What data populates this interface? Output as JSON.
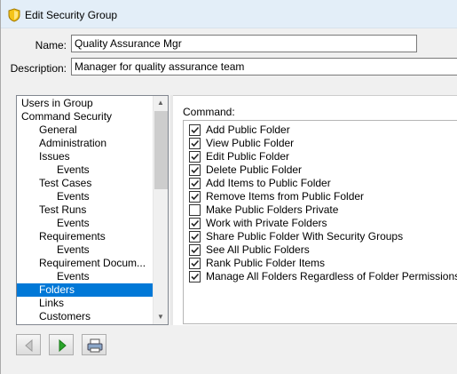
{
  "window": {
    "title": "Edit Security Group"
  },
  "form": {
    "name_label": "Name:",
    "name_value": "Quality Assurance Mgr",
    "description_label": "Description:",
    "description_value": "Manager for quality assurance team"
  },
  "tree": {
    "items": [
      {
        "label": "Users in Group",
        "level": 0,
        "selected": false
      },
      {
        "label": "Command Security",
        "level": 0,
        "selected": false
      },
      {
        "label": "General",
        "level": 1,
        "selected": false
      },
      {
        "label": "Administration",
        "level": 1,
        "selected": false
      },
      {
        "label": "Issues",
        "level": 1,
        "selected": false
      },
      {
        "label": "Events",
        "level": 2,
        "selected": false
      },
      {
        "label": "Test Cases",
        "level": 1,
        "selected": false
      },
      {
        "label": "Events",
        "level": 2,
        "selected": false
      },
      {
        "label": "Test Runs",
        "level": 1,
        "selected": false
      },
      {
        "label": "Events",
        "level": 2,
        "selected": false
      },
      {
        "label": "Requirements",
        "level": 1,
        "selected": false
      },
      {
        "label": "Events",
        "level": 2,
        "selected": false
      },
      {
        "label": "Requirement Docum...",
        "level": 1,
        "selected": false
      },
      {
        "label": "Events",
        "level": 2,
        "selected": false
      },
      {
        "label": "Folders",
        "level": 1,
        "selected": true
      },
      {
        "label": "Links",
        "level": 1,
        "selected": false
      },
      {
        "label": "Customers",
        "level": 1,
        "selected": false
      }
    ]
  },
  "commands": {
    "label": "Command:",
    "items": [
      {
        "label": "Add Public Folder",
        "checked": true
      },
      {
        "label": "View Public Folder",
        "checked": true
      },
      {
        "label": "Edit Public Folder",
        "checked": true
      },
      {
        "label": "Delete Public Folder",
        "checked": true
      },
      {
        "label": "Add Items to Public Folder",
        "checked": true
      },
      {
        "label": "Remove Items from Public Folder",
        "checked": true
      },
      {
        "label": "Make Public Folders Private",
        "checked": false
      },
      {
        "label": "Work with Private Folders",
        "checked": true
      },
      {
        "label": "Share Public Folder With Security Groups",
        "checked": true
      },
      {
        "label": "See All Public Folders",
        "checked": true
      },
      {
        "label": "Rank Public Folder Items",
        "checked": true
      },
      {
        "label": "Manage All Folders Regardless of Folder Permissions",
        "checked": true
      }
    ]
  },
  "toolbar": {
    "buttons": [
      {
        "icon": "previous-icon",
        "enabled": false
      },
      {
        "icon": "next-icon",
        "enabled": true
      },
      {
        "icon": "print-icon",
        "enabled": true
      }
    ]
  },
  "colors": {
    "selection": "#0078d7",
    "title_bar": "#e3eef8",
    "next_arrow": "#2aa52a"
  }
}
